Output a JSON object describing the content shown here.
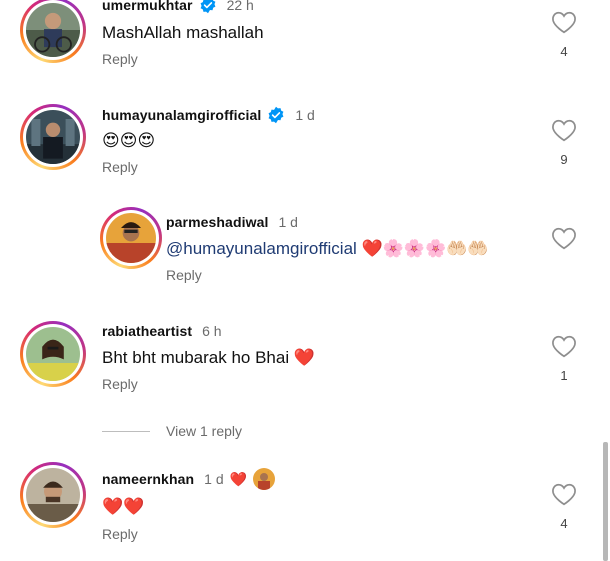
{
  "comments": [
    {
      "username": "umermukhtar",
      "verified": true,
      "time": "22 h",
      "text": "MashAllah mashallah",
      "reply_label": "Reply",
      "likes": "4"
    },
    {
      "username": "humayunalamgirofficial",
      "verified": true,
      "time": "1 d",
      "text": "😍😍😍",
      "reply_label": "Reply",
      "likes": "9"
    },
    {
      "username": "parmeshadiwal",
      "verified": false,
      "time": "1 d",
      "mention": "@humayunalamgirofficial",
      "text": "❤️🌸🌸🌸🤲🏻🤲🏻",
      "reply_label": "Reply",
      "likes": ""
    },
    {
      "username": "rabiatheartist",
      "verified": false,
      "time": "6 h",
      "text": "Bht bht mubarak ho Bhai ❤️",
      "reply_label": "Reply",
      "likes": "1"
    },
    {
      "username": "nameernkhan",
      "verified": false,
      "time": "1 d",
      "meta_extra": "❤️",
      "text": "❤️❤️",
      "reply_label": "Reply",
      "likes": "4"
    }
  ],
  "view_replies_label": "View 1 reply",
  "colors": {
    "verified_blue": "#0095f6",
    "mention": "#1f3b73",
    "muted": "#6b6b6b"
  },
  "icons": {
    "like": "heart-outline-icon",
    "verified": "verified-badge-icon"
  }
}
